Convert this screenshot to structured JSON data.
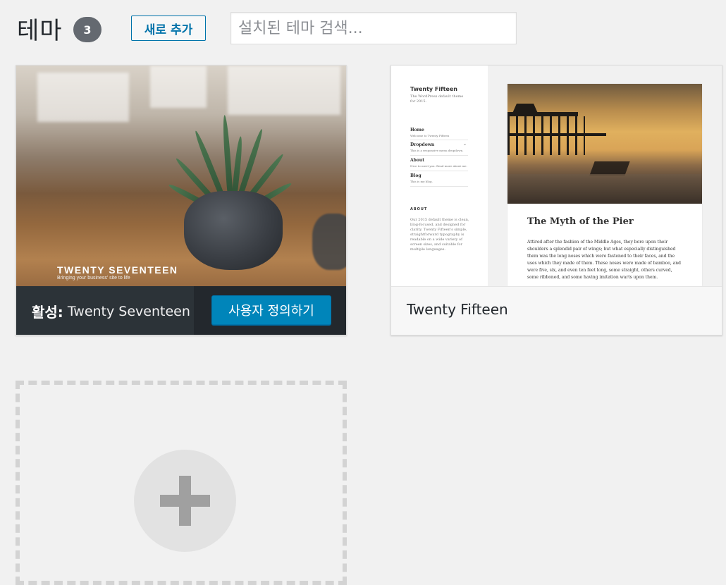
{
  "header": {
    "title": "테마",
    "count": "3",
    "add_new_label": "새로 추가",
    "search_placeholder": "설치된 테마 검색..."
  },
  "themes": [
    {
      "name": "Twenty Seventeen",
      "active": true,
      "active_prefix": "활성:",
      "customize_label": "사용자 정의하기",
      "screenshot": {
        "site_title": "TWENTY SEVENTEEN",
        "tagline": "Bringing your business' site to life"
      }
    },
    {
      "name": "Twenty Fifteen",
      "active": false,
      "screenshot": {
        "site_title": "Twenty Fifteen",
        "site_desc": "The WordPress default theme for 2015.",
        "menu": [
          {
            "label": "Home",
            "desc": "Welcome to Twenty Fifteen"
          },
          {
            "label": "Dropdown",
            "desc": "This is a responsive menu dropdown."
          },
          {
            "label": "About",
            "desc": "Nice to meet you. Read more about me."
          },
          {
            "label": "Blog",
            "desc": "This is my blog."
          }
        ],
        "about_heading": "ABOUT",
        "about_text": "Our 2015 default theme is clean, blog-focused, and designed for clarity. Twenty Fifteen's simple, straightforward typography is readable on a wide variety of screen sizes, and suitable for multiple languages.",
        "post_title": "The Myth of the Pier",
        "post_excerpt": "Attired after the fashion of the Middle Ages, they bore upon their shoulders a splendid pair of wings; but what especially distinguished them was the long noses which were fastened to their faces, and the uses which they made of them. These noses were made of bamboo, and were five, six, and even ten feet long, some straight, others curved, some ribboned, and some having imitation warts upon them."
      }
    }
  ],
  "colors": {
    "primary": "#0085ba",
    "accent_text": "#0073aa",
    "active_bar": "#23282d",
    "background": "#f1f1f1"
  },
  "icons": {
    "add_theme": "plus-icon"
  }
}
